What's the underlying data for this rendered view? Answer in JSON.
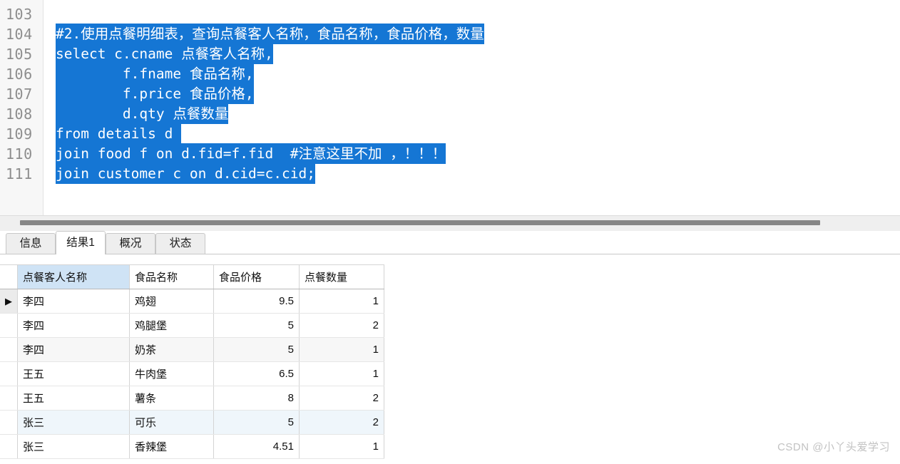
{
  "editor": {
    "first_line_number": 103,
    "selection_color": "#1576d4",
    "selection_text_color": "#ffffff",
    "lines": [
      {
        "no": "103",
        "prefix": "",
        "selected": ""
      },
      {
        "no": "104",
        "prefix": "",
        "selected": "#2.使用点餐明细表，查询点餐客人名称，食品名称，食品价格，数量"
      },
      {
        "no": "105",
        "prefix": "",
        "selected": "select c.cname 点餐客人名称,"
      },
      {
        "no": "106",
        "prefix": "",
        "selected": "        f.fname 食品名称,"
      },
      {
        "no": "107",
        "prefix": "",
        "selected": "        f.price 食品价格,"
      },
      {
        "no": "108",
        "prefix": "",
        "selected": "        d.qty 点餐数量"
      },
      {
        "no": "109",
        "prefix": "",
        "selected": "from details d "
      },
      {
        "no": "110",
        "prefix": "",
        "selected": "join food f on d.fid=f.fid  #注意这里不加 ，！！！"
      },
      {
        "no": "111",
        "prefix": "",
        "selected": "join customer c on d.cid=c.cid;"
      }
    ]
  },
  "scrollbar": {
    "orientation": "horizontal",
    "thumb_color": "#868686",
    "track_color": "#efefef"
  },
  "tabs": [
    {
      "label": "信息",
      "active": false
    },
    {
      "label": "结果1",
      "active": true
    },
    {
      "label": "概况",
      "active": false
    },
    {
      "label": "状态",
      "active": false
    }
  ],
  "result_grid": {
    "columns": [
      "点餐客人名称",
      "食品名称",
      "食品价格",
      "点餐数量"
    ],
    "selected_column": "点餐客人名称",
    "current_row_index": 0,
    "current_row_marker": "▶",
    "rows": [
      {
        "点餐客人名称": "李四",
        "食品名称": "鸡翅",
        "食品价格": "9.5",
        "点餐数量": "1"
      },
      {
        "点餐客人名称": "李四",
        "食品名称": "鸡腿堡",
        "食品价格": "5",
        "点餐数量": "2"
      },
      {
        "点餐客人名称": "李四",
        "食品名称": "奶茶",
        "食品价格": "5",
        "点餐数量": "1"
      },
      {
        "点餐客人名称": "王五",
        "食品名称": "牛肉堡",
        "食品价格": "6.5",
        "点餐数量": "1"
      },
      {
        "点餐客人名称": "王五",
        "食品名称": "薯条",
        "食品价格": "8",
        "点餐数量": "2"
      },
      {
        "点餐客人名称": "张三",
        "食品名称": "可乐",
        "食品价格": "5",
        "点餐数量": "2"
      },
      {
        "点餐客人名称": "张三",
        "食品名称": "香辣堡",
        "食品价格": "4.51",
        "点餐数量": "1"
      }
    ]
  },
  "watermark": {
    "text": "CSDN @小丫头爱学习"
  }
}
